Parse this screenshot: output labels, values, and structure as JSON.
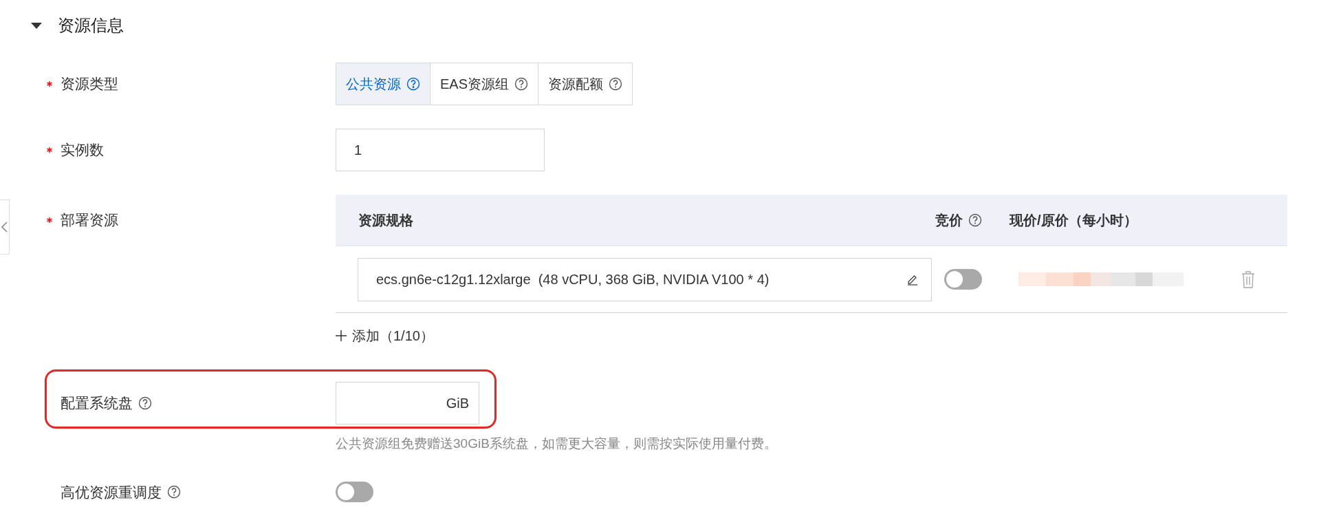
{
  "section": {
    "title": "资源信息",
    "expanded": true
  },
  "fields": [
    {
      "kind": "segmented",
      "label": "资源类型",
      "required": true,
      "options": [
        {
          "label": "公共资源",
          "selected": true
        },
        {
          "label": "EAS资源组",
          "selected": false
        },
        {
          "label": "资源配额",
          "selected": false
        }
      ]
    },
    {
      "kind": "number",
      "label": "实例数",
      "required": true,
      "value": "1"
    },
    {
      "kind": "table",
      "label": "部署资源",
      "required": true,
      "columns": [
        {
          "label": "资源规格",
          "help": false
        },
        {
          "label": "竞价",
          "help": true
        },
        {
          "label": "现价/原价（每小时）",
          "help": false
        }
      ],
      "rows": [
        {
          "spec": "ecs.gn6e-c12g1.12xlarge  (48 vCPU, 368 GiB, NVIDIA V100 * 4)",
          "bidding": false
        }
      ],
      "add_link": "添加（1/10）"
    },
    {
      "kind": "unit-input",
      "label": "配置系统盘",
      "required": false,
      "help": true,
      "highlighted": true,
      "unit": "GiB",
      "hint": "公共资源组免费赠送30GiB系统盘，如需更大容量，则需按实际使用量付费。"
    },
    {
      "kind": "toggle",
      "label": "高优资源重调度",
      "required": false,
      "help": true,
      "on": false
    }
  ]
}
